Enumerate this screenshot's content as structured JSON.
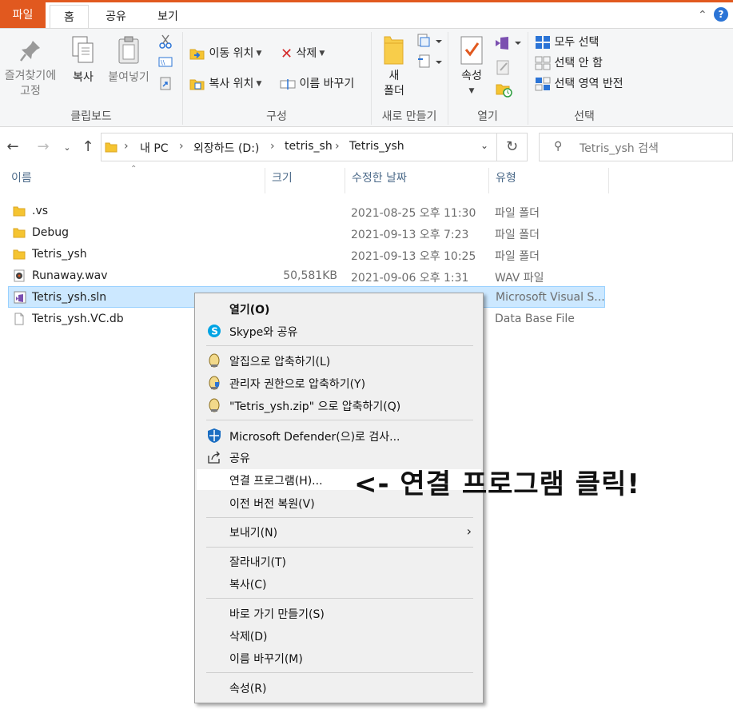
{
  "tabs": {
    "file": "파일",
    "home": "홈",
    "share": "공유",
    "view": "보기"
  },
  "ribbon": {
    "clipboard": {
      "pin_line1": "즐겨찾기에",
      "pin_line2": "고정",
      "copy": "복사",
      "paste": "붙여넣기",
      "group": "클립보드"
    },
    "organize": {
      "move_to": "이동 위치",
      "copy_to": "복사 위치",
      "delete": "삭제",
      "rename": "이름 바꾸기",
      "group": "구성"
    },
    "new": {
      "folder_line1": "새",
      "folder_line2": "폴더",
      "group": "새로 만들기"
    },
    "open": {
      "properties": "속성",
      "group": "열기"
    },
    "select": {
      "select_all": "모두 선택",
      "select_none": "선택 안 함",
      "invert": "선택 영역 반전",
      "group": "선택"
    }
  },
  "address": {
    "crumbs": [
      "내 PC",
      "외장하드 (D:)",
      "tetris_sh",
      "Tetris_ysh"
    ],
    "search_placeholder": "Tetris_ysh 검색"
  },
  "columns": {
    "name": "이름",
    "size": "크기",
    "date": "수정한 날짜",
    "type": "유형"
  },
  "files": [
    {
      "name": ".vs",
      "size": "",
      "date": "2021-08-25 오후 11:30",
      "type": "파일 폴더",
      "icon": "folder-icon"
    },
    {
      "name": "Debug",
      "size": "",
      "date": "2021-09-13 오후 7:23",
      "type": "파일 폴더",
      "icon": "folder-icon"
    },
    {
      "name": "Tetris_ysh",
      "size": "",
      "date": "2021-09-13 오후 10:25",
      "type": "파일 폴더",
      "icon": "folder-icon"
    },
    {
      "name": "Runaway.wav",
      "size": "50,581KB",
      "date": "2021-09-06 오후 1:31",
      "type": "WAV 파일",
      "icon": "audio-file-icon"
    },
    {
      "name": "Tetris_ysh.sln",
      "size": "",
      "date": "",
      "type": "Microsoft Visual S...",
      "icon": "visual-studio-solution-icon"
    },
    {
      "name": "Tetris_ysh.VC.db",
      "size": "",
      "date": "",
      "type": "Data Base File",
      "icon": "database-file-icon"
    }
  ],
  "context_menu": {
    "open": "열기(O)",
    "skype": "Skype와 공유",
    "alzip1": "알집으로 압축하기(L)",
    "alzip2": "관리자 권한으로 압축하기(Y)",
    "alzip3": "\"Tetris_ysh.zip\" 으로 압축하기(Q)",
    "defender": "Microsoft Defender(으)로 검사...",
    "share": "공유",
    "open_with": "연결 프로그램(H)...",
    "restore": "이전 버전 복원(V)",
    "send_to": "보내기(N)",
    "cut": "잘라내기(T)",
    "copy": "복사(C)",
    "shortcut": "바로 가기 만들기(S)",
    "delete": "삭제(D)",
    "rename": "이름 바꾸기(M)",
    "properties": "속성(R)"
  },
  "annotation": "<- 연결 프로그램 클릭!",
  "colors": {
    "accent": "#e1591f",
    "selection": "#cce8ff",
    "menu_bg": "#f0f0f0"
  }
}
